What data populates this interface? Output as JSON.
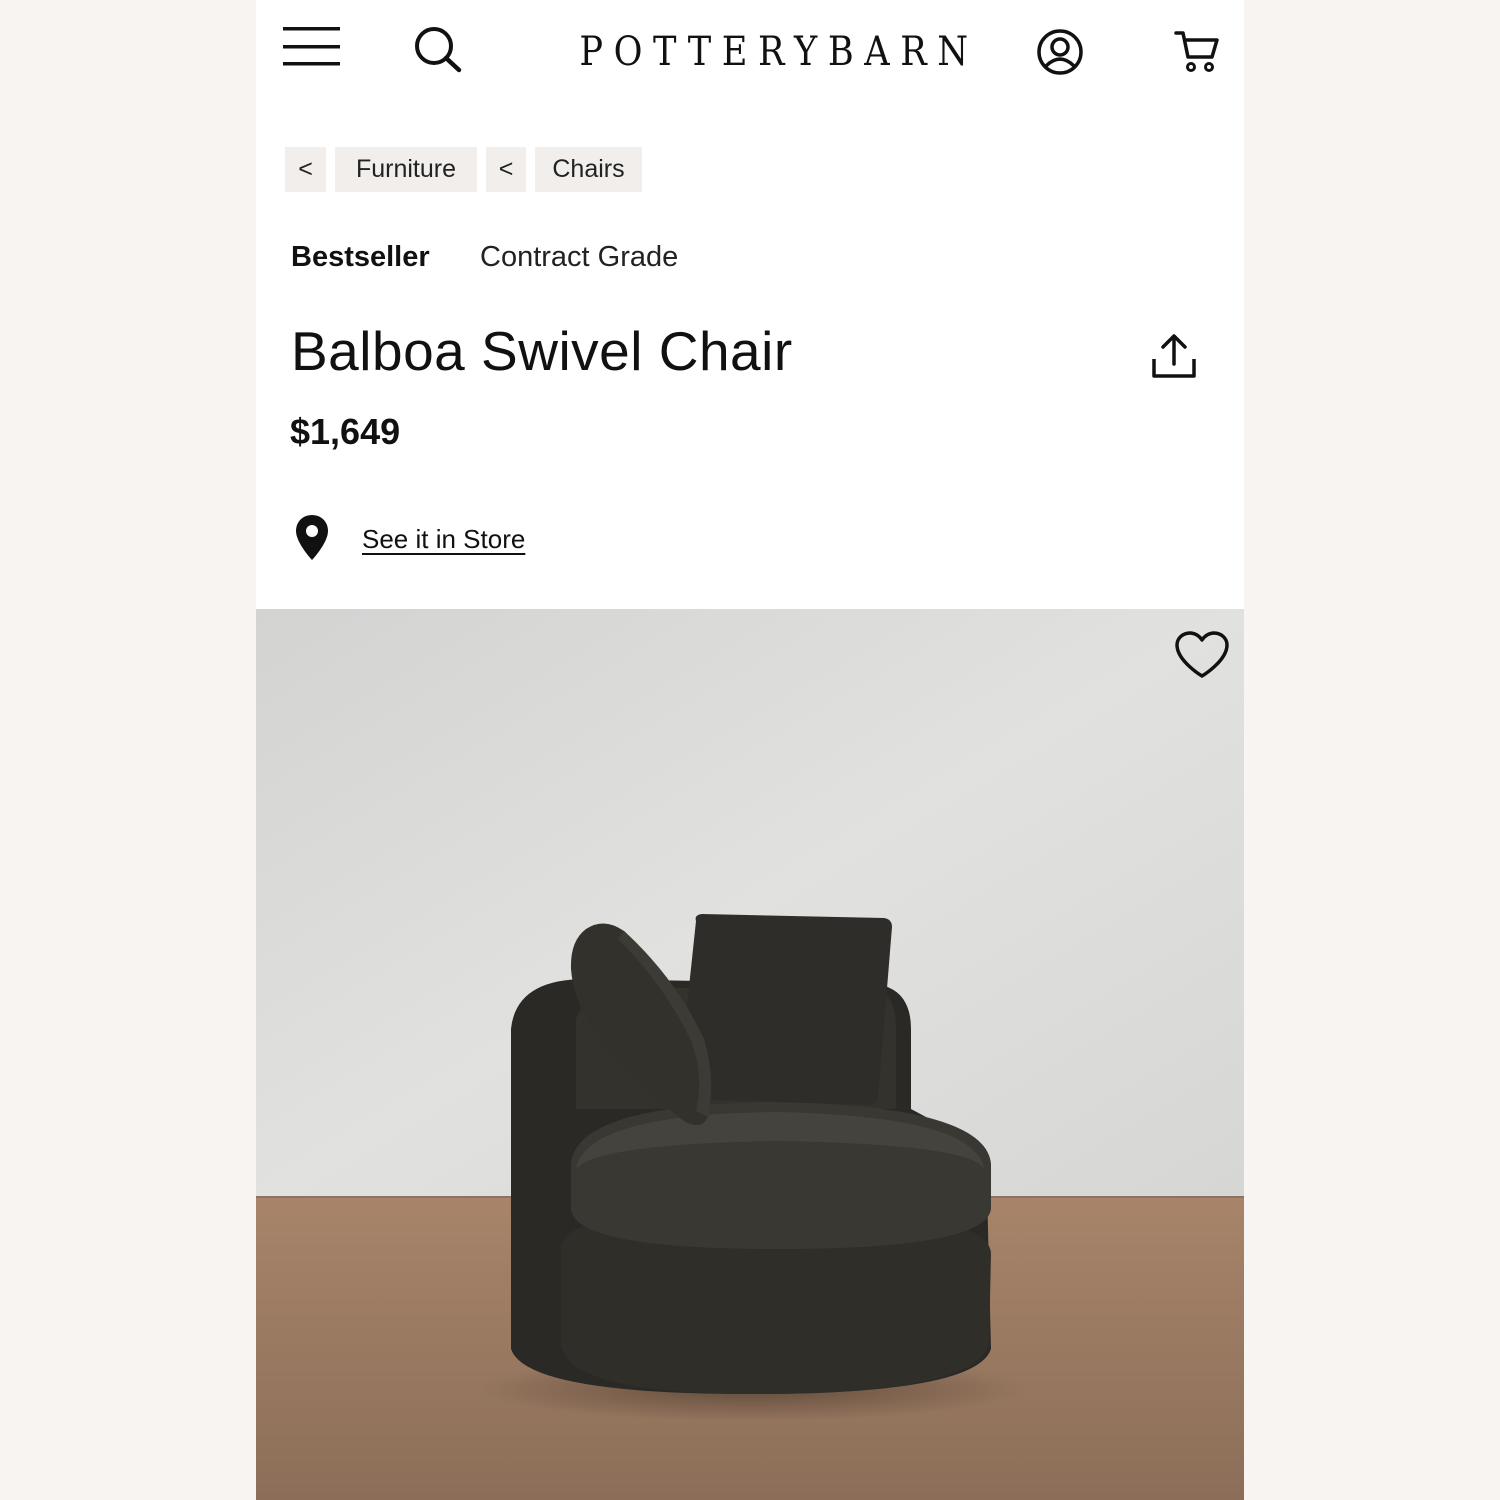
{
  "header": {
    "brand": "POTTERYBARN",
    "menu_icon": "hamburger-menu-icon",
    "search_icon": "search-icon",
    "account_icon": "account-icon",
    "cart_icon": "cart-icon"
  },
  "breadcrumb": {
    "back_glyph": "<",
    "items": [
      {
        "label": "Furniture"
      },
      {
        "label": "Chairs"
      }
    ]
  },
  "badges": [
    "Bestseller",
    "Contract Grade"
  ],
  "product": {
    "title": "Balboa Swivel Chair",
    "price": "$1,649",
    "store_link": "See it in Store",
    "share_icon": "share-icon",
    "favorite_icon": "heart-icon",
    "location_icon": "location-pin-icon"
  },
  "colors": {
    "background": "#f7f4f1",
    "breadcrumb_bg": "#f1eeeb",
    "text": "#111111",
    "chair": "#2f2d28",
    "floor": "#9a7a62",
    "wall": "#d9d9d7"
  }
}
